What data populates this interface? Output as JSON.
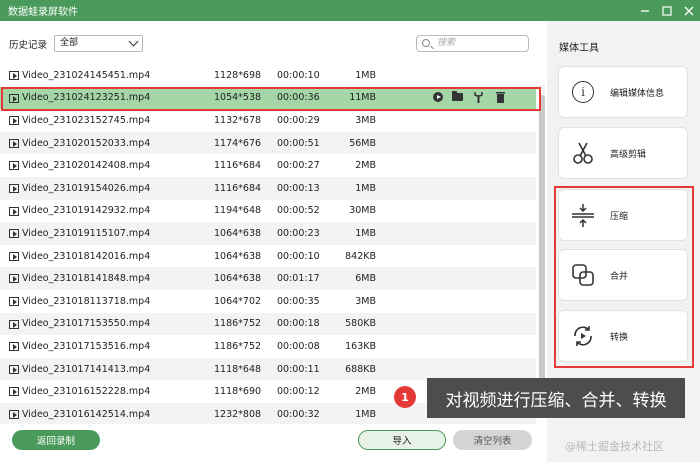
{
  "window": {
    "title": "数据蛙录屏软件",
    "controls": [
      "minimize-icon",
      "maximize-icon",
      "close-icon"
    ]
  },
  "toolbar": {
    "history_label": "历史记录",
    "filter_value": "全部",
    "search_placeholder": "搜索"
  },
  "files": [
    {
      "name": "Video_231024145451.mp4",
      "resolution": "1128*698",
      "duration": "00:00:10",
      "size": "1MB"
    },
    {
      "name": "Video_231024123251.mp4",
      "resolution": "1054*538",
      "duration": "00:00:36",
      "size": "11MB",
      "selected": true
    },
    {
      "name": "Video_231023152745.mp4",
      "resolution": "1132*678",
      "duration": "00:00:29",
      "size": "3MB"
    },
    {
      "name": "Video_231020152033.mp4",
      "resolution": "1174*676",
      "duration": "00:00:51",
      "size": "56MB"
    },
    {
      "name": "Video_231020142408.mp4",
      "resolution": "1116*684",
      "duration": "00:00:27",
      "size": "2MB"
    },
    {
      "name": "Video_231019154026.mp4",
      "resolution": "1116*684",
      "duration": "00:00:13",
      "size": "1MB"
    },
    {
      "name": "Video_231019142932.mp4",
      "resolution": "1194*648",
      "duration": "00:00:52",
      "size": "30MB"
    },
    {
      "name": "Video_231019115107.mp4",
      "resolution": "1064*638",
      "duration": "00:00:23",
      "size": "1MB"
    },
    {
      "name": "Video_231018142016.mp4",
      "resolution": "1064*638",
      "duration": "00:00:10",
      "size": "842KB"
    },
    {
      "name": "Video_231018141848.mp4",
      "resolution": "1064*638",
      "duration": "00:01:17",
      "size": "6MB"
    },
    {
      "name": "Video_231018113718.mp4",
      "resolution": "1064*702",
      "duration": "00:00:35",
      "size": "3MB"
    },
    {
      "name": "Video_231017153550.mp4",
      "resolution": "1186*752",
      "duration": "00:00:18",
      "size": "580KB"
    },
    {
      "name": "Video_231017153516.mp4",
      "resolution": "1186*752",
      "duration": "00:00:08",
      "size": "163KB"
    },
    {
      "name": "Video_231017141413.mp4",
      "resolution": "1118*648",
      "duration": "00:00:11",
      "size": "688KB"
    },
    {
      "name": "Video_231016152228.mp4",
      "resolution": "1118*690",
      "duration": "00:00:12",
      "size": "2MB"
    },
    {
      "name": "Video_231016142514.mp4",
      "resolution": "1232*808",
      "duration": "00:00:32",
      "size": "1MB"
    }
  ],
  "row_actions": [
    "play-icon",
    "folder-icon",
    "wrench-icon",
    "trash-icon"
  ],
  "buttons": {
    "back": "返回录制",
    "import": "导入",
    "clear": "清空列表"
  },
  "media_tools": {
    "header": "媒体工具",
    "items": [
      {
        "label": "编辑媒体信息",
        "icon": "info-icon"
      },
      {
        "label": "高级剪辑",
        "icon": "scissors-icon"
      },
      {
        "label": "压缩",
        "icon": "compress-icon"
      },
      {
        "label": "合并",
        "icon": "merge-icon"
      },
      {
        "label": "转换",
        "icon": "convert-icon"
      }
    ]
  },
  "annotation": {
    "number": "1",
    "text": "对视频进行压缩、合并、转换"
  },
  "watermark": "@稀土掘金技术社区",
  "colors": {
    "brand_green": "#4a9b5b",
    "selected_row": "#a5d6a7",
    "highlight_red": "#e53935"
  }
}
